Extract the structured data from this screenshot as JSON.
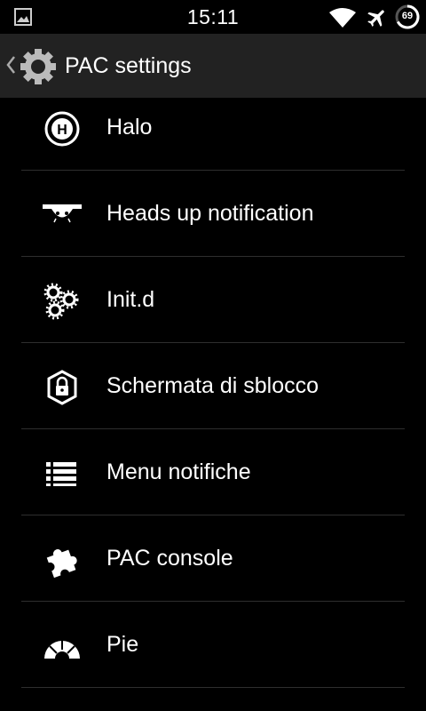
{
  "status_bar": {
    "time": "15:11",
    "battery_level": "69",
    "icons": [
      "image-icon",
      "wifi-icon",
      "airplane-icon",
      "battery-icon"
    ]
  },
  "action_bar": {
    "title": "PAC settings",
    "icon": "gear-icon"
  },
  "items": [
    {
      "label": "Halo",
      "icon": "halo-icon"
    },
    {
      "label": "Heads up notification",
      "icon": "heads-up-icon"
    },
    {
      "label": "Init.d",
      "icon": "gears-icon"
    },
    {
      "label": "Schermata di sblocco",
      "icon": "lock-icon"
    },
    {
      "label": "Menu notifiche",
      "icon": "list-icon"
    },
    {
      "label": "PAC console",
      "icon": "puzzle-icon"
    },
    {
      "label": "Pie",
      "icon": "pie-icon"
    }
  ],
  "colors": {
    "background": "#000000",
    "action_bar": "#222222",
    "divider": "#2e2e2e",
    "text": "#ffffff"
  }
}
